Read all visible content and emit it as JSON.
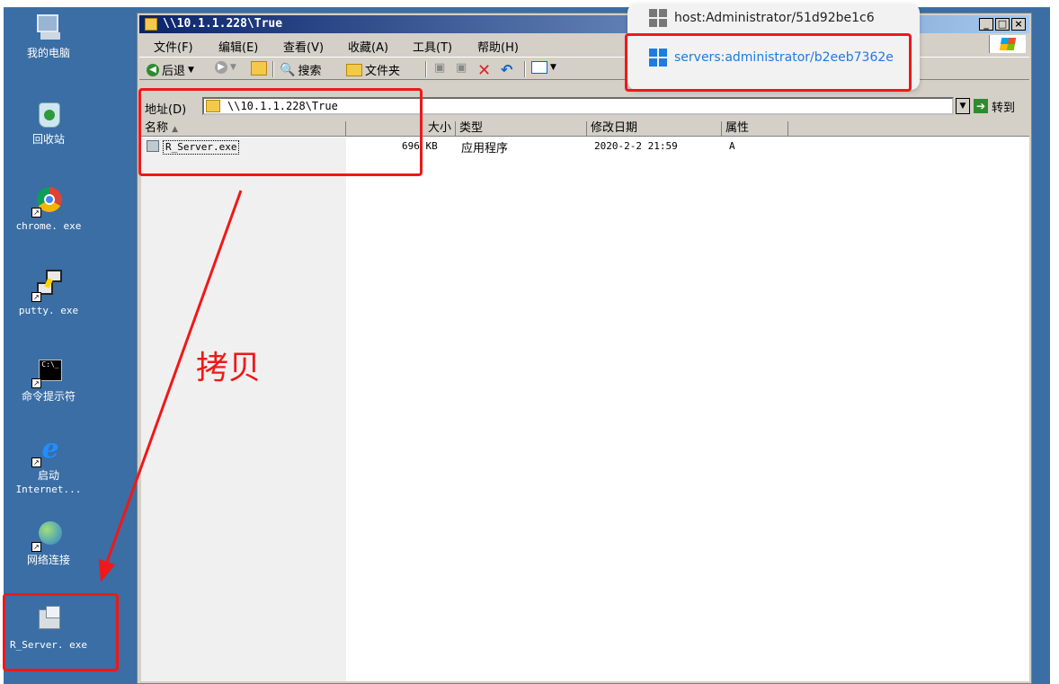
{
  "desktop": {
    "icons": [
      {
        "label": "我的电脑"
      },
      {
        "label": "回收站"
      },
      {
        "label": "chrome. exe"
      },
      {
        "label": "putty. exe"
      },
      {
        "label": "命令提示符"
      },
      {
        "label": "启动",
        "label2": "Internet..."
      },
      {
        "label": "网络连接"
      },
      {
        "label": "R_Server. exe"
      }
    ]
  },
  "window": {
    "title": "\\\\10.1.1.228\\True",
    "menu": [
      "文件(F)",
      "编辑(E)",
      "查看(V)",
      "收藏(A)",
      "工具(T)",
      "帮助(H)"
    ],
    "toolbar": {
      "back": "后退",
      "search": "搜索",
      "folders": "文件夹"
    },
    "address": {
      "label": "地址(D)",
      "value": "\\\\10.1.1.228\\True",
      "go": "转到"
    },
    "columns": [
      "名称",
      "大小",
      "类型",
      "修改日期",
      "属性"
    ],
    "rows": [
      {
        "name": "R_Server.exe",
        "size": "696 KB",
        "type": "应用程序",
        "modified": "2020-2-2 21:59",
        "attr": "A"
      }
    ]
  },
  "popup": {
    "items": [
      {
        "label": "host:Administrator/51d92be1c6"
      },
      {
        "label": "servers:administrator/b2eeb7362e"
      }
    ],
    "colors": {
      "selected": "#1e7be0"
    }
  },
  "annotation": {
    "text": "拷贝",
    "color": "#f01818"
  }
}
